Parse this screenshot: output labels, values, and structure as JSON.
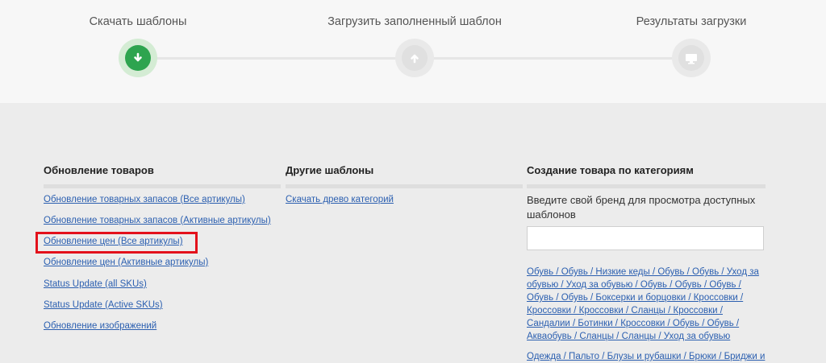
{
  "steps": [
    {
      "label": "Скачать шаблоны",
      "icon": "download-arrow-icon",
      "state": "active"
    },
    {
      "label": "Загрузить заполненный шаблон",
      "icon": "upload-arrow-icon",
      "state": "inactive"
    },
    {
      "label": "Результаты загрузки",
      "icon": "monitor-icon",
      "state": "inactive"
    }
  ],
  "update_products": {
    "title": "Обновление товаров",
    "links": [
      "Обновление товарных запасов (Все артикулы)",
      "Обновление товарных запасов (Активные артикулы)",
      "Обновление цен (Все артикулы)",
      "Обновление цен (Активные артикулы)",
      "Status Update (all SKUs)",
      "Status Update (Active SKUs)",
      "Обновление изображений"
    ]
  },
  "other_templates": {
    "title": "Другие шаблоны",
    "links": [
      "Скачать древо категорий"
    ]
  },
  "create_by_category": {
    "title": "Создание товара по категориям",
    "hint": "Введите свой бренд для просмотра доступных шаблонов",
    "input_value": "",
    "category_links": [
      "Обувь / Обувь / Низкие кеды / Обувь / Обувь / Уход за обувью / Уход за обувью / Обувь / Обувь / Обувь / Обувь / Обувь / Боксерки и борцовки / Кроссовки / Кроссовки / Кроссовки / Сланцы / Кроссовки / Сандалии / Ботинки / Кроссовки / Обувь / Обувь / Аквaобувь / Сланцы / Сланцы / Уход за обувью",
      "Одежда / Пальто / Блузы и рубашки / Брюки / Бриджи и"
    ]
  },
  "colors": {
    "active_green": "#2ea44f",
    "link_blue": "#2b5fb0",
    "highlight_red": "#e3111b"
  }
}
